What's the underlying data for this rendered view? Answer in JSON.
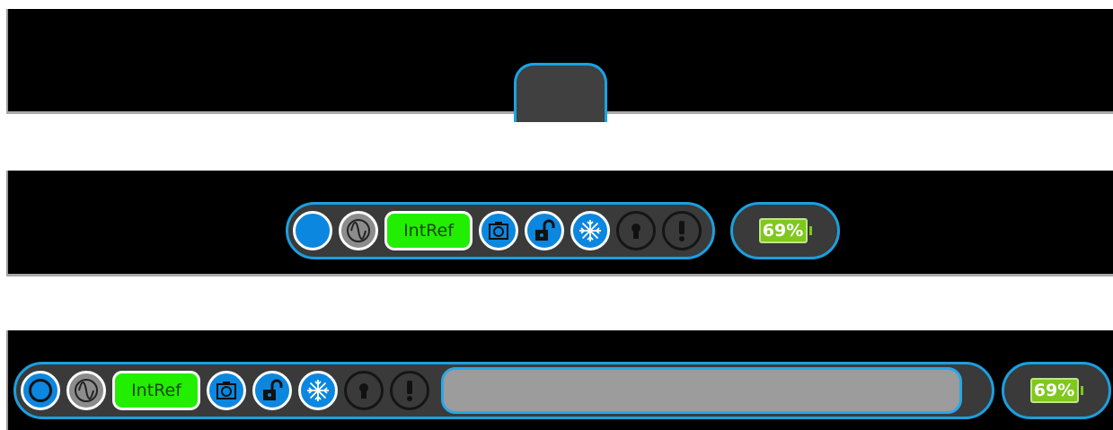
{
  "panels": [
    {
      "id": "collapsed",
      "state": "collapsed"
    },
    {
      "id": "compact",
      "state": "compact"
    },
    {
      "id": "expanded",
      "state": "expanded"
    }
  ],
  "toolbar": {
    "reference_label": "IntRef",
    "icons": [
      "run-indicator",
      "waveform-icon",
      "intref-badge",
      "camera-icon",
      "unlock-icon",
      "snowflake-icon",
      "keyhole-icon",
      "exclamation-icon"
    ]
  },
  "battery": {
    "percent_label": "69%",
    "level": 0.69
  },
  "colors": {
    "accent": "#1aa0e0",
    "green": "#22ee00",
    "battery": "#7fc81e",
    "panel": "#000000",
    "bar": "#3a3a3a"
  }
}
